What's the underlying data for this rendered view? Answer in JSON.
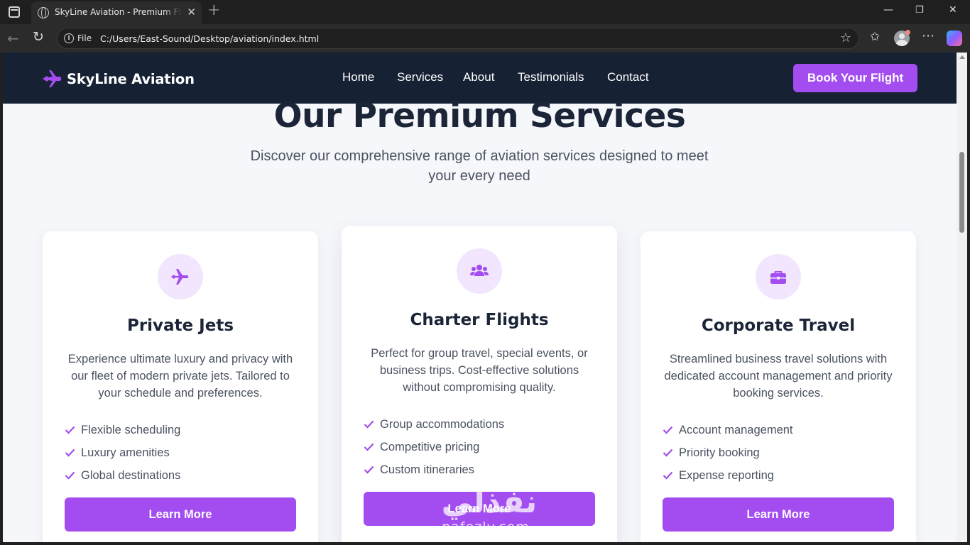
{
  "browser": {
    "tab_title": "SkyLine Aviation - Premium Flight Services",
    "tab_close": "✕",
    "new_tab": "+",
    "scheme_label": "File",
    "url": "C:/Users/East-Sound/Desktop/aviation/index.html",
    "icons": [
      "window-menu-icon",
      "globe-icon",
      "back-icon",
      "reload-icon",
      "info-icon",
      "star-icon",
      "favorites-icon",
      "profile-icon",
      "more-icon",
      "copilot-icon"
    ]
  },
  "site": {
    "brand": "SkyLine Aviation",
    "nav": [
      "Home",
      "Services",
      "About",
      "Testimonials",
      "Contact"
    ],
    "cta": "Book Your Flight",
    "accent_color": "#a34df0",
    "header_bg": "#162233"
  },
  "services": {
    "title": "Our Premium Services",
    "subtitle": "Discover our comprehensive range of aviation services designed to meet your every need",
    "cards": [
      {
        "icon": "plane-icon",
        "title": "Private Jets",
        "description": "Experience ultimate luxury and privacy with our fleet of modern private jets. Tailored to your schedule and preferences.",
        "features": [
          "Flexible scheduling",
          "Luxury amenities",
          "Global destinations"
        ],
        "button": "Learn More"
      },
      {
        "icon": "users-icon",
        "title": "Charter Flights",
        "description": "Perfect for group travel, special events, or business trips. Cost-effective solutions without compromising quality.",
        "features": [
          "Group accommodations",
          "Competitive pricing",
          "Custom itineraries"
        ],
        "button": "Learn More"
      },
      {
        "icon": "briefcase-icon",
        "title": "Corporate Travel",
        "description": "Streamlined business travel solutions with dedicated account management and priority booking services.",
        "features": [
          "Account management",
          "Priority booking",
          "Expense reporting"
        ],
        "button": "Learn More"
      }
    ]
  },
  "watermark": {
    "arabic": "نفذلي",
    "latin": "nafezly.com"
  }
}
